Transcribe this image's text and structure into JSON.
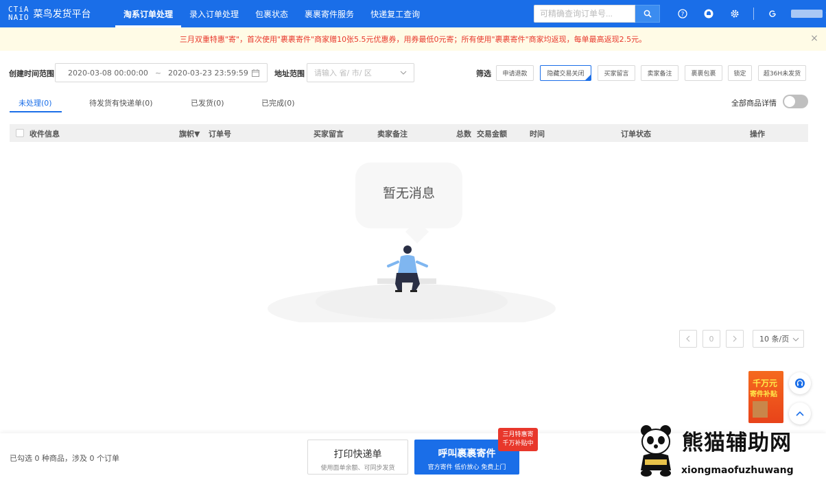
{
  "app": {
    "logo_mark_line1": "CTiA",
    "logo_mark_line2": "NAIO",
    "logo_text": "菜鸟发货平台"
  },
  "nav": {
    "items": [
      {
        "label": "淘系订单处理",
        "active": true
      },
      {
        "label": "录入订单处理",
        "active": false
      },
      {
        "label": "包裹状态",
        "active": false
      },
      {
        "label": "裹裹寄件服务",
        "active": false
      },
      {
        "label": "快递复工查询",
        "active": false
      }
    ],
    "search_placeholder": "可精确查询订单号..."
  },
  "banner": {
    "text": "三月双重特惠\"寄\"，首次使用\"裹裹寄件\"商家赠10张5.5元优惠券，用券最低0元寄；所有使用\"裹裹寄件\"商家均返现，每单最高返现2.5元。"
  },
  "filters": {
    "created_time_label": "创建时间范围",
    "start_time": "2020-03-08 00:00:00",
    "time_separator": "~",
    "end_time": "2020-03-23 23:59:59",
    "address_label": "地址范围",
    "address_placeholder": "请输入 省/ 市/ 区",
    "screen_label": "筛选",
    "tags": [
      {
        "label": "申请退款",
        "selected": false
      },
      {
        "label": "隐藏交易关闭",
        "selected": true
      },
      {
        "label": "买家留言",
        "selected": false
      },
      {
        "label": "卖家备注",
        "selected": false
      },
      {
        "label": "裹裹包裹",
        "selected": false
      },
      {
        "label": "锁定",
        "selected": false
      },
      {
        "label": "超36H未发货",
        "selected": false
      }
    ]
  },
  "tabs": {
    "items": [
      {
        "label": "未处理(0)",
        "active": true
      },
      {
        "label": "待发货有快递单(0)",
        "active": false
      },
      {
        "label": "已发货(0)",
        "active": false
      },
      {
        "label": "已完成(0)",
        "active": false
      }
    ],
    "toggle_label": "全部商品详情",
    "toggle_on": false
  },
  "table": {
    "columns": {
      "recipient": "收件信息",
      "flag": "旗帜▼",
      "order_no": "订单号",
      "buyer_msg": "买家留言",
      "seller_note": "卖家备注",
      "total": "总数",
      "amount": "交易金额",
      "time": "时间",
      "status": "订单状态",
      "action": "操作"
    },
    "empty_text": "暂无消息"
  },
  "pagination": {
    "current_page": "0",
    "page_size": "10 条/页"
  },
  "promo": {
    "line1": "千万元",
    "line2": "寄件补贴"
  },
  "bottom": {
    "selection_info": "已勾选 0 种商品，涉及 0 个订单",
    "print_label": "打印快递单",
    "print_sub": "使用面单余额、可同步发货",
    "call_label": "呼叫裹裹寄件",
    "call_sub": "官方寄件 低价放心 免费上门",
    "badge_line1": "三月特惠寄",
    "badge_line2": "千万补贴中"
  },
  "watermark": {
    "title": "熊猫辅助网",
    "url": "xiongmaofuzhuwang"
  },
  "colors": {
    "brand": "#1a6ee8",
    "banner_bg": "#fffbe6",
    "banner_text": "#e8372b",
    "badge_red": "#e8372b"
  }
}
